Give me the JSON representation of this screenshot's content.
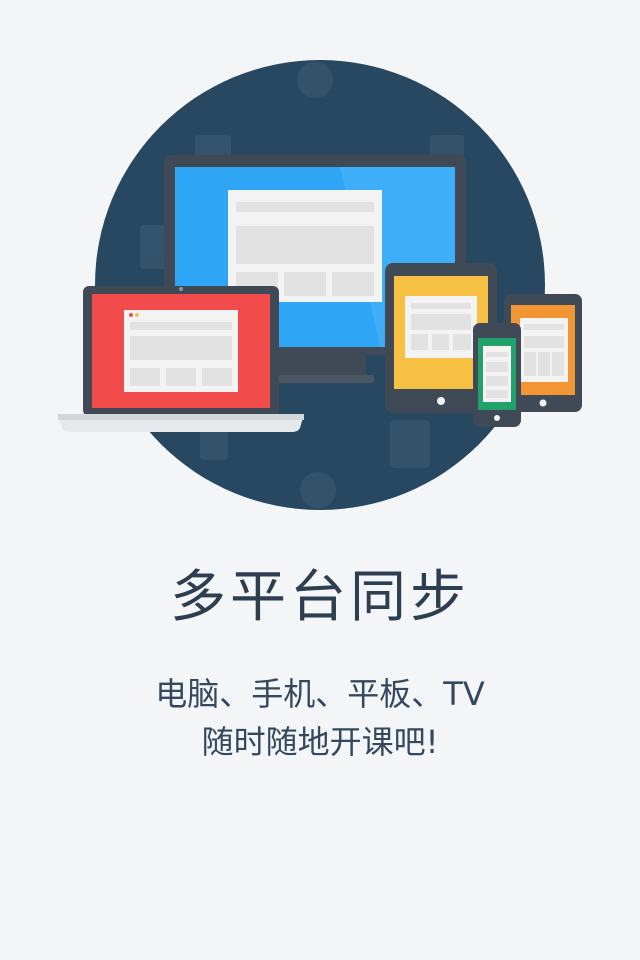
{
  "onboarding": {
    "title": "多平台同步",
    "subtitle_line1": "电脑、手机、平板、TV",
    "subtitle_line2": "随时随地开课吧!"
  },
  "colors": {
    "background": "#f4f5f7",
    "circle": "#284760",
    "monitor_screen": "#2ea6f5",
    "laptop_screen": "#f24b4b",
    "tablet_screen": "#f6c142",
    "phone_small_screen": "#22a16a",
    "phone_right_screen": "#f19633",
    "device_frame": "#3f4a56",
    "title_text": "#2c3e50"
  },
  "icons": {
    "illustration": "multi-device-sync-illustration"
  }
}
